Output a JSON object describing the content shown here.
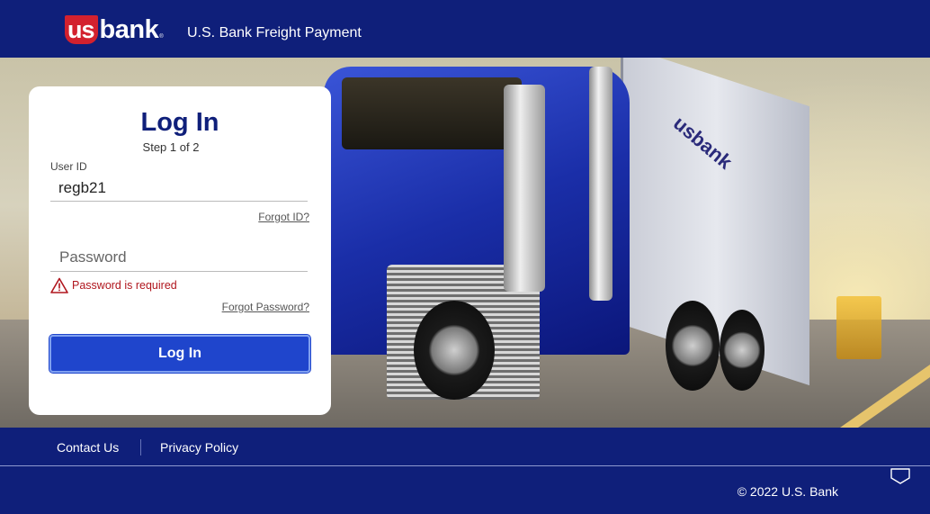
{
  "header": {
    "logo_us": "us",
    "logo_bank": "bank",
    "logo_reg": "®",
    "app_title": "U.S. Bank Freight Payment"
  },
  "hero": {
    "trailer_logo": "usbank"
  },
  "login": {
    "title": "Log In",
    "step": "Step 1 of 2",
    "userid_label": "User ID",
    "userid_value": "regb21",
    "forgot_id": "Forgot ID?",
    "password_placeholder": "Password",
    "password_error": "Password is required",
    "forgot_password": "Forgot Password?",
    "submit_label": "Log In"
  },
  "footer": {
    "contact": "Contact Us",
    "privacy": "Privacy Policy",
    "copyright": "© 2022 U.S. Bank"
  },
  "icons": {
    "warning": "warning-triangle-icon",
    "feedback": "feedback-icon"
  },
  "colors": {
    "brand_navy": "#0f1f7a",
    "brand_red": "#d3212e",
    "button_blue": "#1f45cc",
    "error_red": "#b0161e"
  }
}
